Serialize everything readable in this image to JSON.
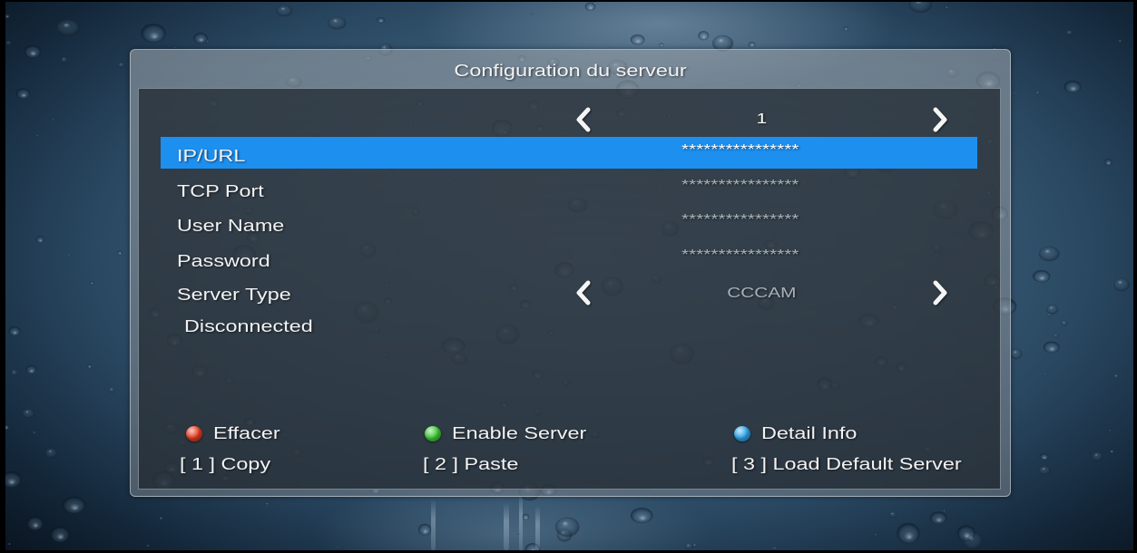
{
  "dialog": {
    "title": "Configuration du serveur"
  },
  "server_selector": {
    "value": "1",
    "prev_icon": "chevron-left-icon",
    "next_icon": "chevron-right-icon"
  },
  "fields": {
    "ip_url": {
      "label": "IP/URL",
      "value": "****************",
      "selected": true
    },
    "tcp_port": {
      "label": "TCP Port",
      "value": "****************",
      "selected": false
    },
    "user_name": {
      "label": "User Name",
      "value": "****************",
      "selected": false
    },
    "password": {
      "label": "Password",
      "value": "****************",
      "selected": false
    }
  },
  "server_type": {
    "label": "Server Type",
    "value": "CCCAM",
    "prev_icon": "chevron-left-icon",
    "next_icon": "chevron-right-icon"
  },
  "status": {
    "text": "Disconnected"
  },
  "color_keys": {
    "red": {
      "label": "Effacer",
      "color": "#e23a1e",
      "icon": "red-button-icon"
    },
    "green": {
      "label": "Enable Server",
      "color": "#3ec934",
      "icon": "green-button-icon"
    },
    "blue": {
      "label": "Detail Info",
      "color": "#2ba2e8",
      "icon": "blue-button-icon"
    }
  },
  "number_keys": {
    "key_1": "[ 1 ] Copy",
    "key_2": "[ 2 ] Paste",
    "key_3": "[ 3 ] Load Default Server"
  },
  "theme": {
    "highlight_color": "#1d8fef",
    "text_color": "#f2f2f2",
    "value_color": "#a9b1b9"
  }
}
